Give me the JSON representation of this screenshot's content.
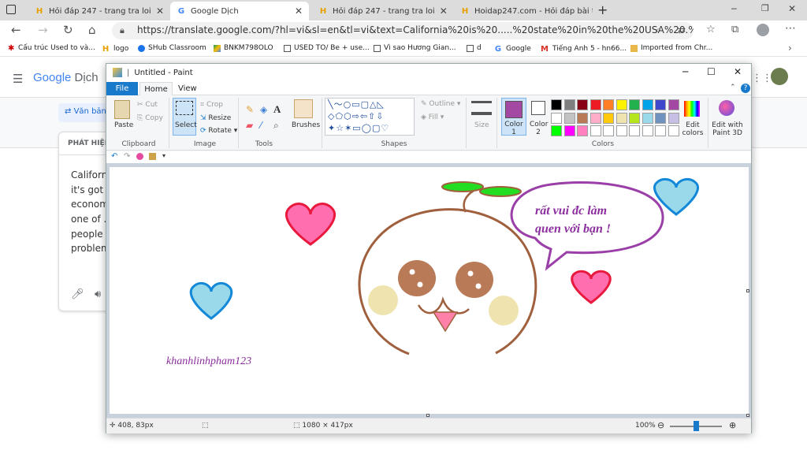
{
  "browser": {
    "tabs": [
      {
        "title": "Hỏi đáp 247 - trang tra loi",
        "icon": "hoidap-favicon"
      },
      {
        "title": "Google Dịch",
        "icon": "google-translate-favicon"
      },
      {
        "title": "Hỏi đáp 247 - trang tra loi",
        "icon": "hoidap-favicon"
      },
      {
        "title": "Hoidap247.com - Hỏi đáp bài tậ",
        "icon": "hoidap-favicon"
      }
    ],
    "new_tab": "+",
    "url": "https://translate.google.com/?hl=vi&sl=en&tl=vi&text=California%20is%20.....%20state%20in%20the%20USA%20.%20It...",
    "bookmarks": [
      "Cấu trúc Used to và...",
      "logo",
      "SHub Classroom",
      "BNKM798OLO",
      "USED TO/ Be + use...",
      "Vì sao Hương Gian...",
      "d",
      "Google",
      "Tiếng Anh 5 - hn66...",
      "Imported from Chr..."
    ]
  },
  "translate": {
    "logo_google": "Google",
    "logo_dich": "Dịch",
    "doc_button": "Văn bản",
    "detect_label": "PHÁT HIỆN",
    "source_lines": [
      "Californi",
      "it's got ...",
      "econom",
      "one of ..",
      "people v",
      "problem"
    ]
  },
  "paint": {
    "title": "Untitled - Paint",
    "tabs": {
      "file": "File",
      "home": "Home",
      "view": "View"
    },
    "clipboard": {
      "paste": "Paste",
      "cut": "Cut",
      "copy": "Copy",
      "group": "Clipboard"
    },
    "image": {
      "select": "Select",
      "crop": "Crop",
      "resize": "Resize",
      "rotate": "Rotate",
      "group": "Image"
    },
    "tools_group": "Tools",
    "brushes": "Brushes",
    "shapes": {
      "outline": "Outline",
      "fill": "Fill",
      "group": "Shapes"
    },
    "size": "Size",
    "color1": "Color 1",
    "color2": "Color 2",
    "colors_group": "Colors",
    "edit_colors": "Edit colors",
    "edit_paint3d": "Edit with Paint 3D",
    "palette_row1": [
      "#000000",
      "#7f7f7f",
      "#880015",
      "#ed1c24",
      "#ff7f27",
      "#fff200",
      "#22b14c",
      "#00a2e8",
      "#3f48cc",
      "#a349a4"
    ],
    "palette_row2": [
      "#ffffff",
      "#c3c3c3",
      "#b97a57",
      "#ffaec9",
      "#ffc90e",
      "#efe4b0",
      "#b5e61d",
      "#99d9ea",
      "#7092be",
      "#c8bfe7"
    ],
    "palette_row3": [
      "#00ff00",
      "#ff00ff",
      "#ff80c0"
    ],
    "color1_value": "#a349a4",
    "status": {
      "cursor": "408, 83px",
      "size": "1080 × 417px",
      "zoom": "100%"
    }
  },
  "drawing": {
    "speech_line1": "rất vui đc làm",
    "speech_line2": "quen với bạn !",
    "signature": "khanhlinhpham123"
  }
}
